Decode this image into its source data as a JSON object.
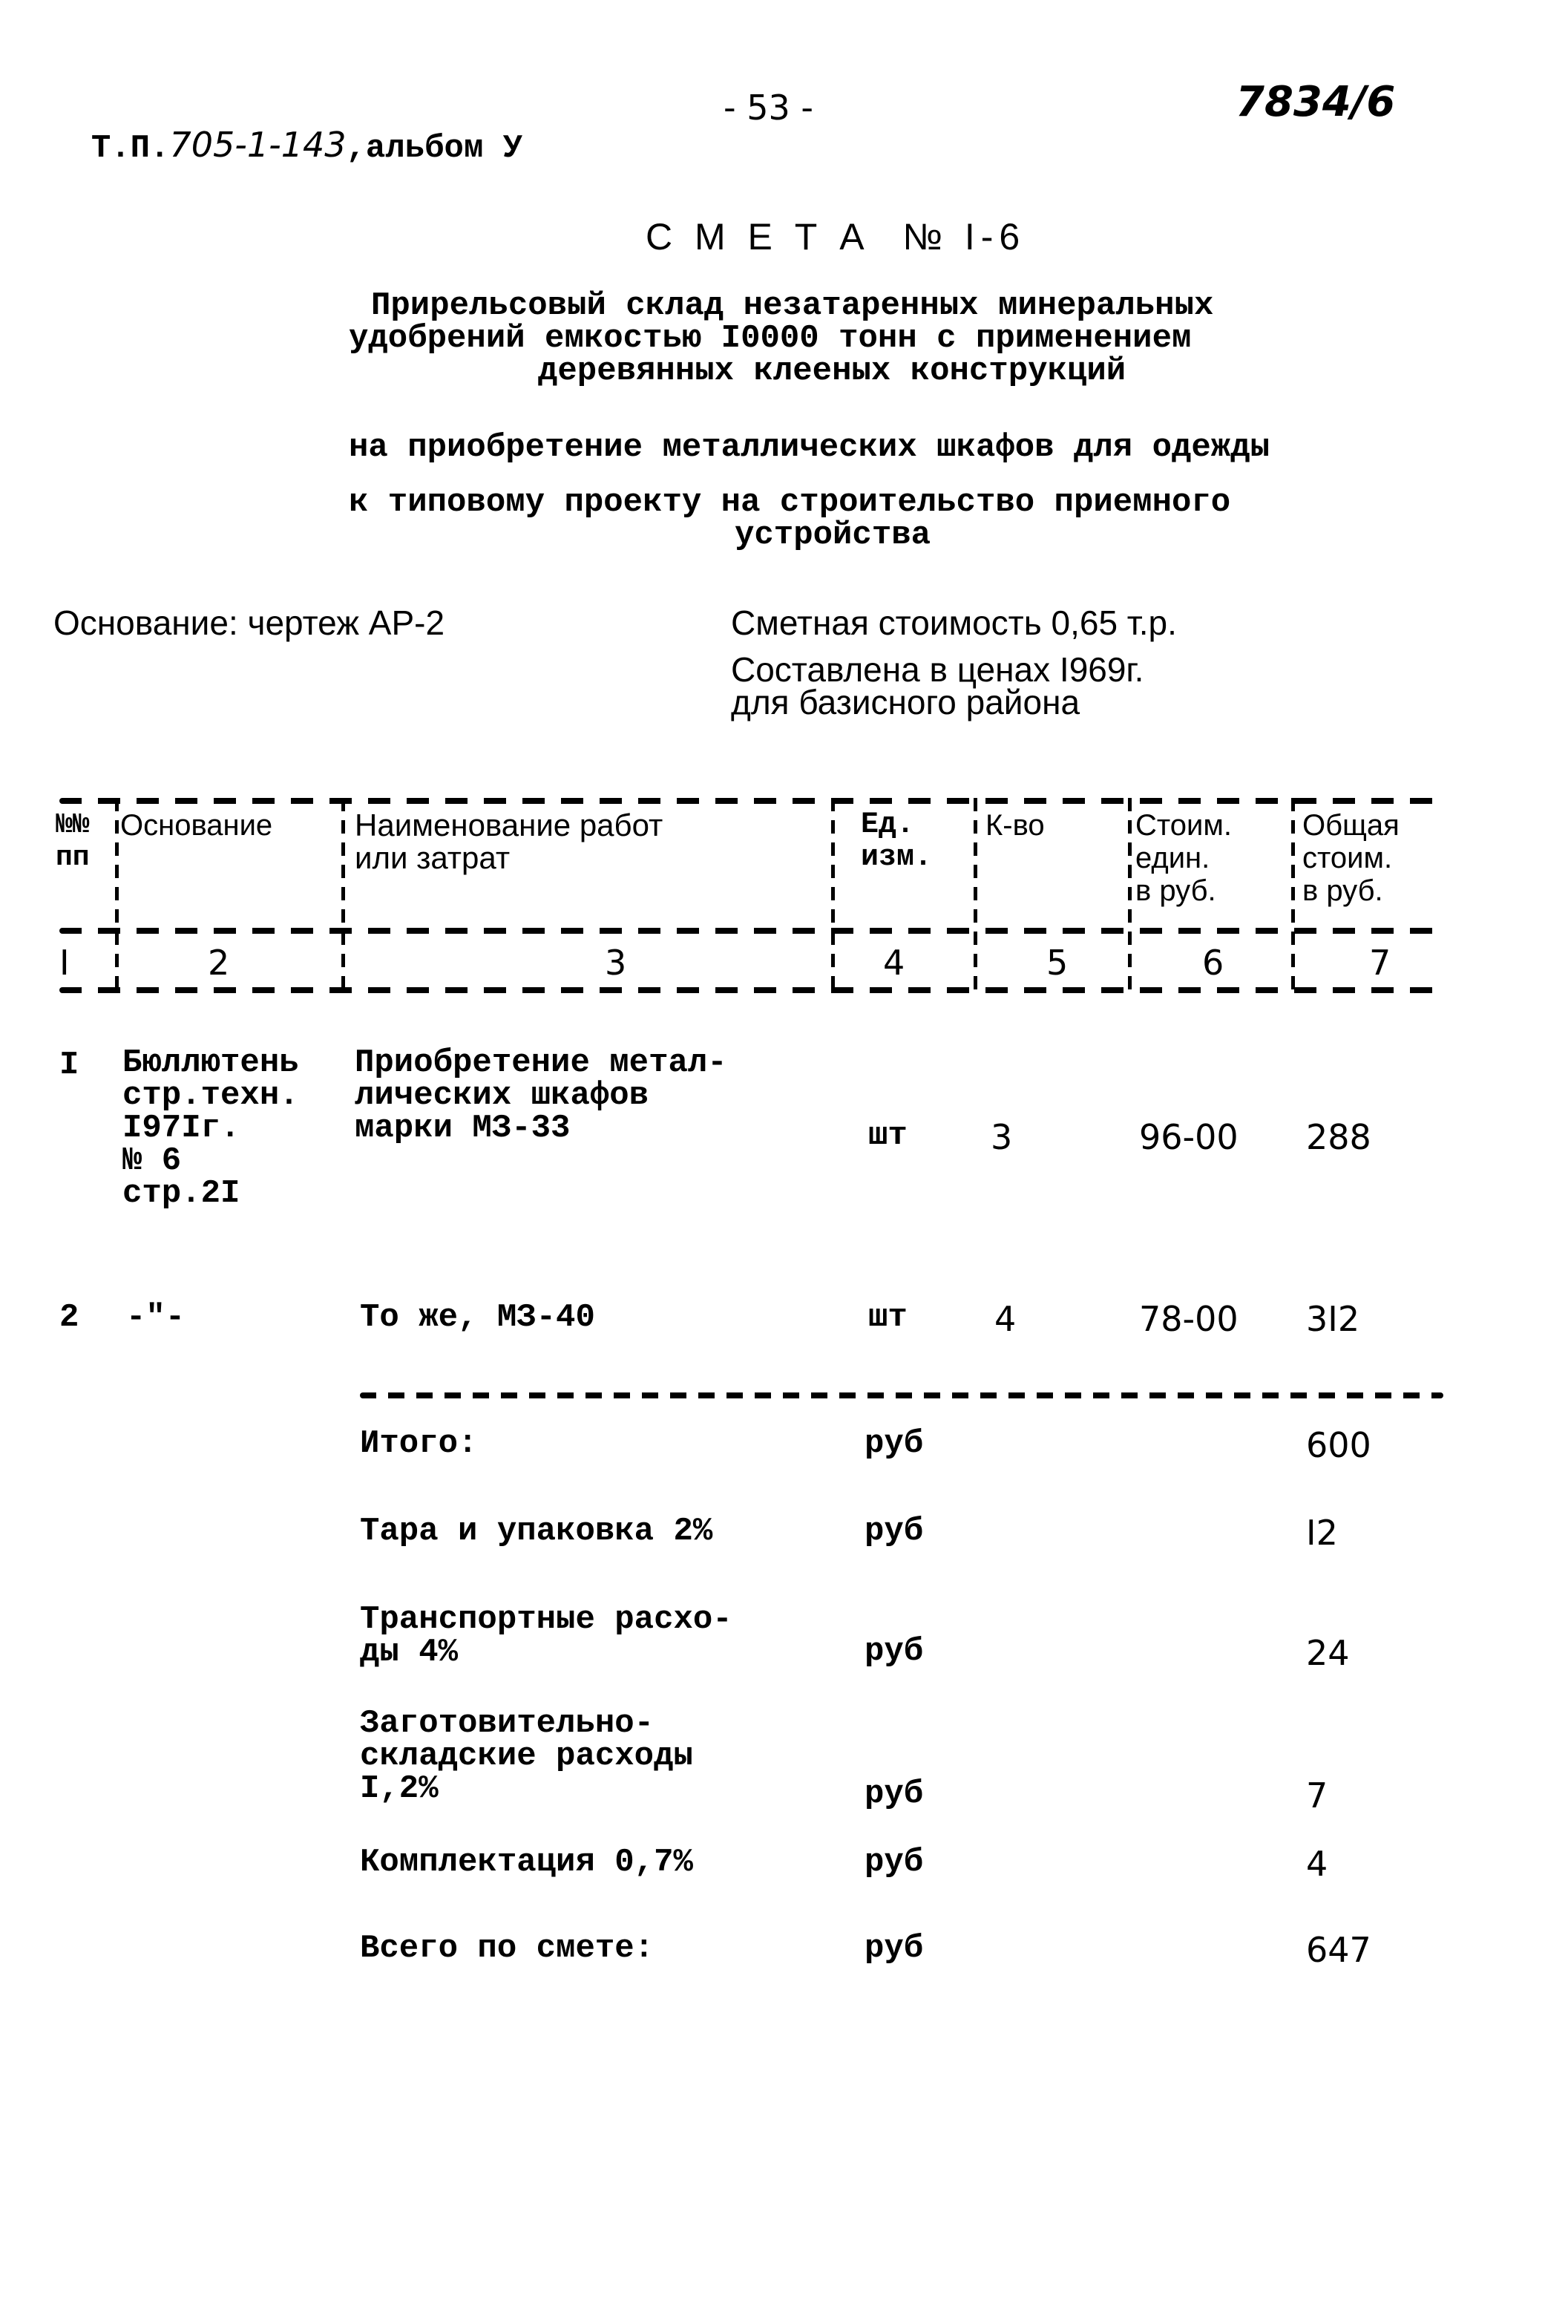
{
  "header": {
    "prefix": "Т.П.",
    "project_number": "705-1-143",
    "album": ",альбом У",
    "page_number": "- 53 -",
    "inventory_number": "7834/6"
  },
  "title": {
    "heading": "С М Е Т А  № I-6",
    "subtitle_lines": [
      "Прирельсовый склад незатаренных минеральных",
      "удобрений емкостью I0000 тонн с применением",
      "деревянных клееных конструкций"
    ],
    "purpose": "на приобретение металлических шкафов для одежды",
    "project_lines": [
      "к типовому проекту на строительство приемного",
      "устройства"
    ]
  },
  "info": {
    "basis": "Основание: чертеж АР-2",
    "estimated_cost": "Сметная стоимость 0,65 т.р.",
    "prices_line1": "Составлена в ценах I969г.",
    "prices_line2": "для базисного района"
  },
  "table": {
    "headers": [
      [
        "№№",
        "пп"
      ],
      [
        "Основание"
      ],
      [
        "Наименование работ",
        "или затрат"
      ],
      [
        "Ед.",
        "изм."
      ],
      [
        "К-во"
      ],
      [
        "Стоим.",
        "един.",
        "в руб."
      ],
      [
        "Общая",
        "стоим.",
        "в руб."
      ]
    ],
    "column_numbers": [
      "I",
      "2",
      "3",
      "4",
      "5",
      "6",
      "7"
    ],
    "rows": [
      {
        "no": "I",
        "basis": [
          "Бюллютень",
          "стр.техн.",
          "I97Iг.",
          "№ 6",
          "стр.2I"
        ],
        "name": [
          "Приобретение метал-",
          "лических шкафов",
          "марки МЗ-33"
        ],
        "unit": "шт",
        "qty": "3",
        "unit_cost": "96-00",
        "total": "288"
      },
      {
        "no": "2",
        "basis": [
          "-\"-"
        ],
        "name": [
          "То же, МЗ-40"
        ],
        "unit": "шт",
        "qty": "4",
        "unit_cost": "78-00",
        "total": "3I2"
      }
    ]
  },
  "summary": [
    {
      "label": [
        "Итого:"
      ],
      "unit": "руб",
      "value": "600"
    },
    {
      "label": [
        "Тара и упаковка 2%"
      ],
      "unit": "руб",
      "value": "I2"
    },
    {
      "label": [
        "Транспортные расхо-",
        "ды 4%"
      ],
      "unit": "руб",
      "value": "24"
    },
    {
      "label": [
        "Заготовительно-",
        "складские расходы",
        "I,2%"
      ],
      "unit": "руб",
      "value": "7"
    },
    {
      "label": [
        "Комплектация 0,7%"
      ],
      "unit": "руб",
      "value": "4"
    },
    {
      "label": [
        "Всего по смете:"
      ],
      "unit": "руб",
      "value": "647"
    }
  ]
}
